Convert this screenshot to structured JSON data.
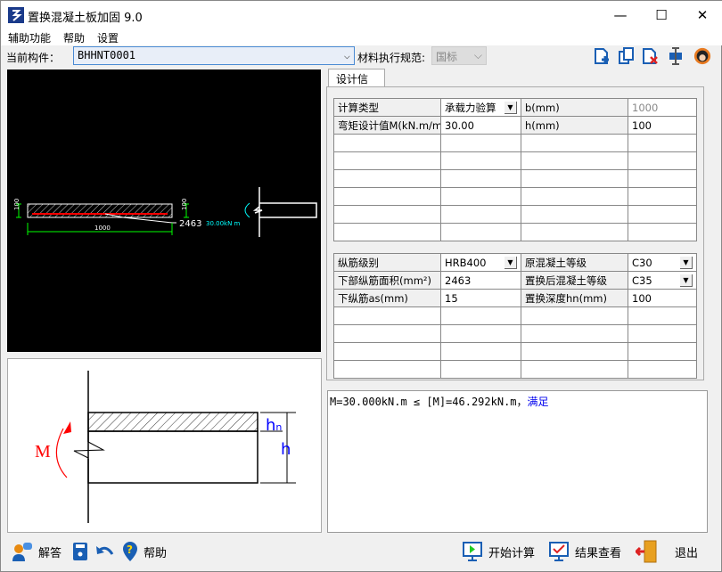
{
  "window": {
    "title": "置换混凝土板加固 9.0",
    "minimize": "—",
    "maximize": "☐",
    "close": "✕"
  },
  "menu": [
    "辅助功能",
    "帮助",
    "设置"
  ],
  "toolbar": {
    "component_label": "当前构件：",
    "component_value": "BHHNT0001",
    "code_label": "材料执行规范:",
    "code_value": "国标"
  },
  "tab": "设计信息",
  "table1": [
    [
      "计算类型",
      "承载力验算",
      "b(mm)",
      "1000"
    ],
    [
      "弯矩设计值M(kN.m/m)",
      "30.00",
      "h(mm)",
      "100"
    ]
  ],
  "table2": [
    [
      "纵筋级别",
      "HRB400",
      "原混凝土等级",
      "C30"
    ],
    [
      "下部纵筋面积(mm²)",
      "2463",
      "置换后混凝土等级",
      "C35"
    ],
    [
      "下纵筋as(mm)",
      "15",
      "置换深度hn(mm)",
      "100"
    ]
  ],
  "canvas": {
    "dim_h_left": "100",
    "dim_h_right": "100",
    "width": "1000",
    "area": "2463",
    "moment": "30.00kN m"
  },
  "diagram": {
    "moment": "M",
    "hn": "h",
    "hn_sub": "n",
    "h": "h"
  },
  "result": {
    "text": "M=30.000kN.m ≤ [M]=46.292kN.m，",
    "status": "满足"
  },
  "bottom": {
    "answer": "解答",
    "help": "帮助",
    "start": "开始计算",
    "results": "结果查看",
    "exit": "退出"
  },
  "colors": {
    "accent": "#1a5fb4",
    "ok": "#0000ee",
    "rebar": "#ff0000",
    "dim": "#00ff00",
    "moment": "#00ffff"
  }
}
